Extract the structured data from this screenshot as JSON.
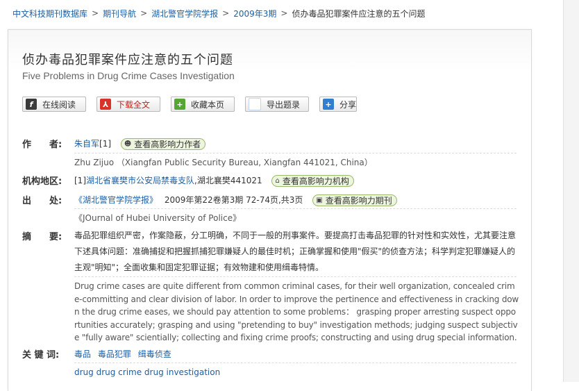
{
  "breadcrumb": {
    "items": [
      "中文科技期刊数据库",
      "期刊导航",
      "湖北警官学院学报",
      "2009年3期"
    ],
    "current": "侦办毒品犯罪案件应注意的五个问题",
    "separator": ">"
  },
  "article": {
    "title_cn": "侦办毒品犯罪案件应注意的五个问题",
    "title_en": "Five Problems in Drug Crime Cases Investigation"
  },
  "toolbar": {
    "read_label": "在线阅读",
    "download_label": "下载全文",
    "favorite_label": "收藏本页",
    "export_label": "导出题录",
    "share_label": "分享"
  },
  "author": {
    "label": "作　　者:",
    "name": "朱自军",
    "ref": "[1]",
    "button": "查看高影响力作者",
    "en_line": "Zhu Zijuo （Xiangfan Public Security Bureau, Xiangfan 441021, China）"
  },
  "institution": {
    "label": "机构地区:",
    "ref": "[1]",
    "name": "湖北省襄樊市公安局禁毒支队",
    "suffix": ",湖北襄樊441021",
    "button": "查看高影响力机构"
  },
  "source": {
    "label": "出　　处:",
    "journal": "《湖北警官学院学报》",
    "detail": "2009年第22卷第3期 72-74页,共3页",
    "button": "查看高影响力期刊",
    "en_line": "《JOurnal of Hubei University of Police》"
  },
  "abstract": {
    "label": "摘　　要:",
    "cn": "毒品犯罪组织严密，作案隐蔽，分工明确，不同于一般的刑事案件。要提高打击毒品犯罪的针对性和实效性，尤其要注意下述具体问题：准确捕捉和把握抓捕犯罪嫌疑人的最佳时机；正确掌握和使用\"假买\"的侦查方法；科学判定犯罪嫌疑人的主观\"明知\"；全面收集和固定犯罪证据；有效物建和使用缉毒特情。",
    "en": "Drug crime cases are quite different from common criminal cases, for their well organization, concealed crime-committing and clear division of labor. In order to improve the pertinence and effectiveness in cracking down the drug crime eases, we should pay attention to some problems： grasping proper arresting suspect opportunities accurately; grasping and using \"pretending to buy\" investigation methods; judging suspect subjective \"fully aware\" scientially; collecting and fixing crime proofs; constructing and using drug special information."
  },
  "keywords": {
    "label": "关 键 词:",
    "cn": [
      "毒品",
      "毒品犯罪",
      "缉毒侦查"
    ],
    "en": "drug drug crime drug investigation"
  },
  "colors": {
    "link": "#1a5fa8",
    "pill_bg": "#eef5df",
    "pill_border": "#9ab86a",
    "pdf_red": "#d8332a"
  }
}
